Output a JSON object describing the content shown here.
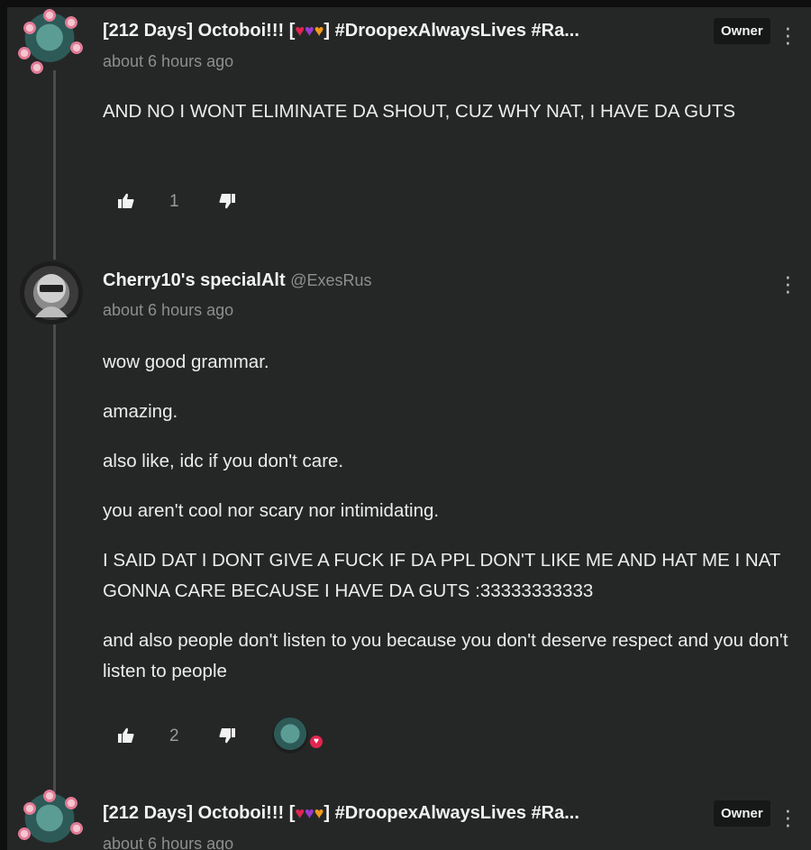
{
  "comments": [
    {
      "author": "[212 Days] Octoboi!!! [",
      "author_suffix": "] #DroopexAlwaysLives #Ra...",
      "hearts": [
        "❤️",
        "💜",
        "🧡"
      ],
      "badge": "Owner",
      "timestamp": "about 6 hours ago",
      "paragraphs": [
        "AND NO I WONT ELIMINATE DA SHOUT, CUZ WHY NAT, I HAVE DA GUTS"
      ],
      "likes": "1"
    },
    {
      "author": "Cherry10's specialAlt",
      "handle": "@ExesRus",
      "timestamp": "about 6 hours ago",
      "paragraphs": [
        "wow good grammar.",
        "amazing.",
        "also like, idc if you don't care.",
        "you aren't cool nor scary nor intimidating.",
        "I SAID DAT I DONT GIVE A FUCK IF DA PPL DON'T LIKE ME AND HAT ME I NAT GONNA CARE BECAUSE I HAVE DA GUTS :33333333333",
        "and also people don't listen to you because you don't deserve respect and you don't listen to people"
      ],
      "likes": "2",
      "reaction": "heart"
    },
    {
      "author": "[212 Days] Octoboi!!! [",
      "author_suffix": "] #DroopexAlwaysLives #Ra...",
      "hearts": [
        "❤️",
        "💜",
        "🧡"
      ],
      "badge": "Owner",
      "timestamp": "about 6 hours ago"
    }
  ],
  "icons": {
    "like": "thumbs-up-icon",
    "dislike": "thumbs-down-icon",
    "menu": "more-vertical-icon"
  },
  "colors": {
    "background": "#252727",
    "heart_red": "#e0264e",
    "heart_purple": "#9b3bd1",
    "heart_orange": "#f39a1a"
  }
}
